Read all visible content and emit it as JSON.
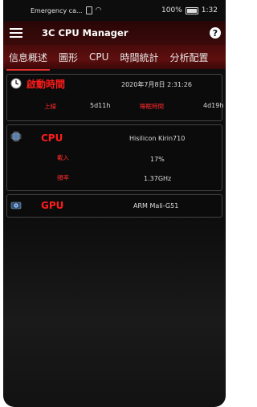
{
  "status_bar": {
    "carrier": "Emergency ca...",
    "battery": "100%",
    "time": "1:32"
  },
  "app": {
    "title": "3C CPU Manager"
  },
  "tabs": [
    "信息概述",
    "圖形",
    "CPU",
    "時間統計",
    "分析配置"
  ],
  "uptime_card": {
    "title": "啟動時間",
    "datetime": "2020年7月8日 2:31:26",
    "label_uptime": "上線",
    "uptime_value": "5d11h",
    "label_sleep": "睡眠時間",
    "sleep_value": "4d19h"
  },
  "cpu_card": {
    "title": "CPU",
    "model": "Hisilicon Kirin710",
    "label_load": "載入",
    "load_value": "17%",
    "label_freq": "頻率",
    "freq_value": "1.37GHz"
  },
  "gpu_card": {
    "title": "GPU",
    "model": "ARM Mali-G51"
  },
  "colors": {
    "accent_red": "#ff1b1b",
    "tab_bar": "#5e0e0e",
    "app_bar": "#3a0a0a"
  }
}
